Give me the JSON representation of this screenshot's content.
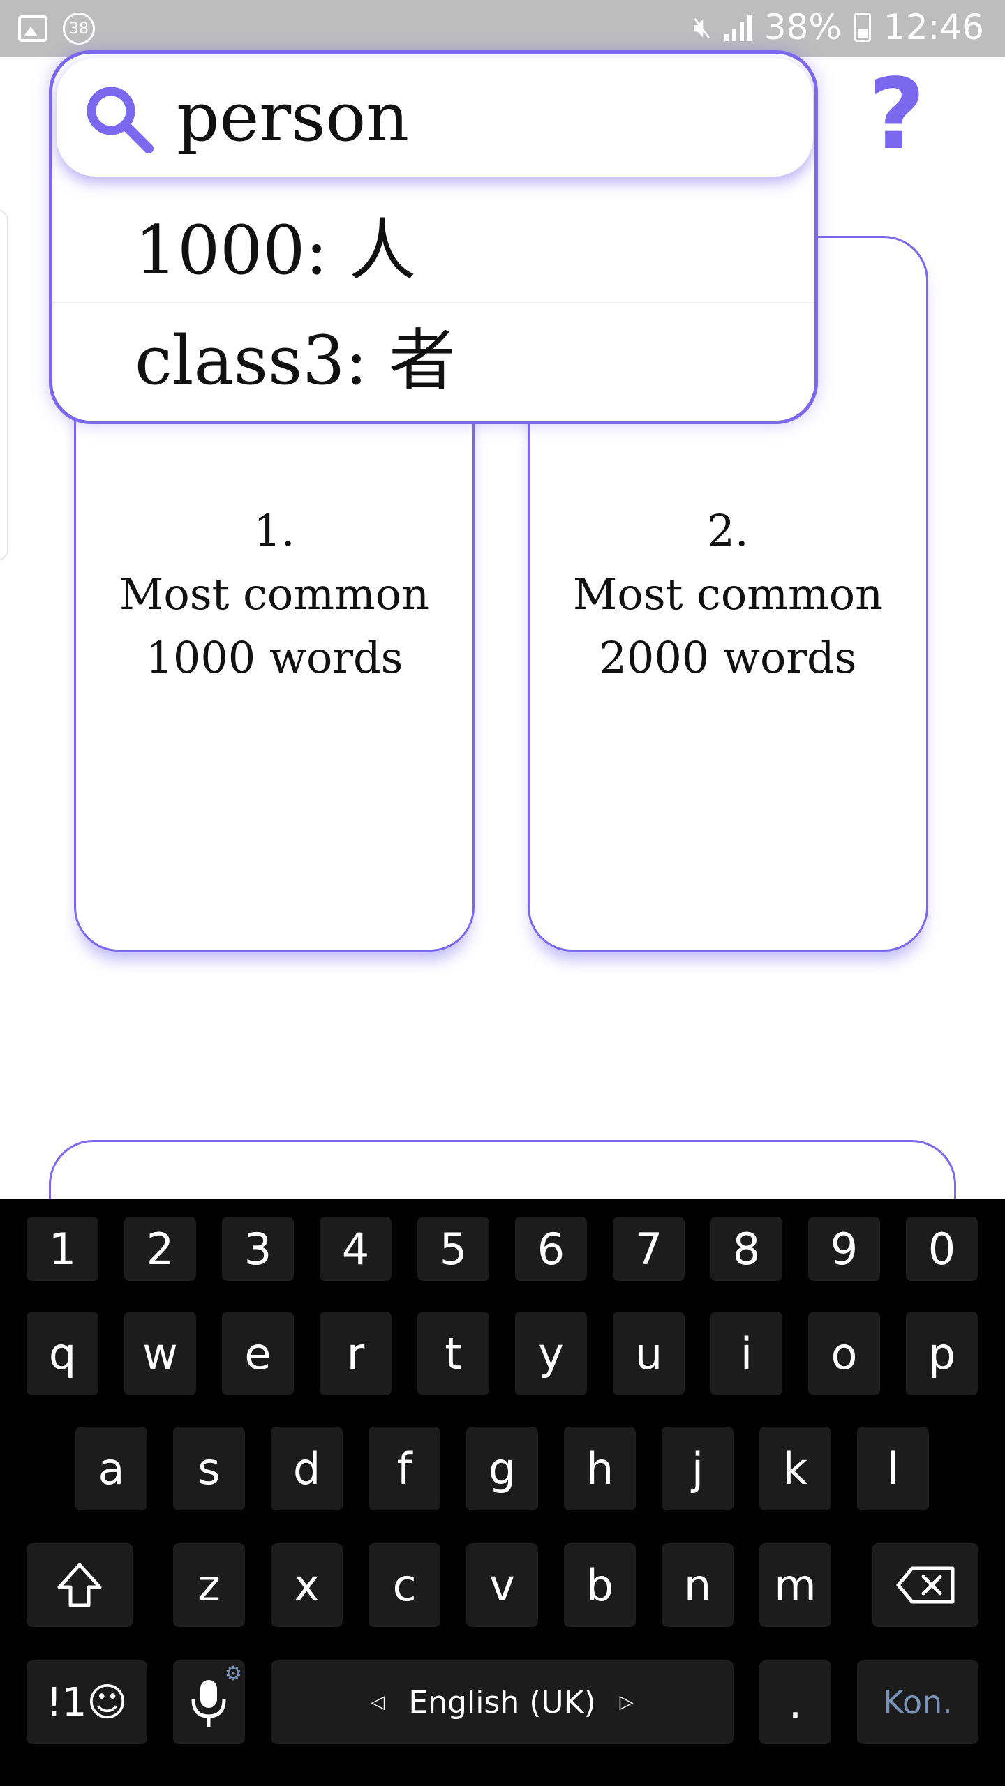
{
  "status_bar": {
    "notification_count": "38",
    "battery_percent": "38%",
    "time": "12:46"
  },
  "search": {
    "query": "person",
    "placeholder": ""
  },
  "results": [
    {
      "label": "1000: 人"
    },
    {
      "label": "class3: 者"
    }
  ],
  "help": {
    "label": "?"
  },
  "cards": [
    {
      "number": "1.",
      "title": "Most common",
      "count": "1000 words"
    },
    {
      "number": "2.",
      "title": "Most common",
      "count": "2000 words"
    }
  ],
  "keyboard": {
    "row_numbers": [
      "1",
      "2",
      "3",
      "4",
      "5",
      "6",
      "7",
      "8",
      "9",
      "0"
    ],
    "row_1": [
      "q",
      "w",
      "e",
      "r",
      "t",
      "y",
      "u",
      "i",
      "o",
      "p"
    ],
    "row_2": [
      "a",
      "s",
      "d",
      "f",
      "g",
      "h",
      "j",
      "k",
      "l"
    ],
    "row_3": [
      "z",
      "x",
      "c",
      "v",
      "b",
      "n",
      "m"
    ],
    "symbols_label": "!1☺",
    "space_label": "English (UK)",
    "period_label": ".",
    "action_label": "Kon."
  },
  "colors": {
    "accent": "#7b68ee",
    "status_bar_bg": "#bdbdbd",
    "keyboard_bg": "#000000",
    "key_bg": "#1c1c1c",
    "action_key_text": "#7a93b8"
  },
  "icons": [
    "image-icon",
    "notification-count-icon",
    "mute-icon",
    "signal-icon",
    "battery-icon",
    "search-icon",
    "help-icon",
    "shift-icon",
    "backspace-icon",
    "microphone-icon",
    "settings-gear-icon",
    "arrow-left-icon",
    "arrow-right-icon"
  ]
}
